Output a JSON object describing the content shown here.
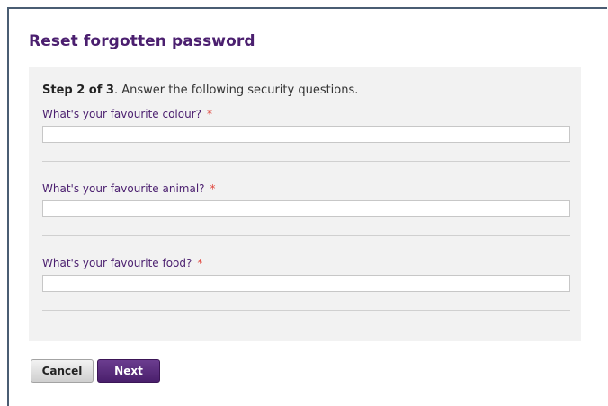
{
  "page": {
    "title": "Reset forgotten password"
  },
  "form": {
    "step_bold": "Step 2 of 3",
    "step_rest": ". Answer the following security questions.",
    "required_marker": "*",
    "questions": [
      {
        "label": "What's your favourite colour?",
        "value": "",
        "placeholder": ""
      },
      {
        "label": "What's your favourite animal?",
        "value": "",
        "placeholder": ""
      },
      {
        "label": "What's your favourite food?",
        "value": "",
        "placeholder": ""
      }
    ]
  },
  "actions": {
    "cancel_label": "Cancel",
    "next_label": "Next"
  },
  "colors": {
    "title": "#4b1f6f",
    "question_label": "#4b1f6f",
    "required": "#e0443a",
    "panel_background": "#f2f2f2",
    "primary_button": "#4a1f6c"
  }
}
